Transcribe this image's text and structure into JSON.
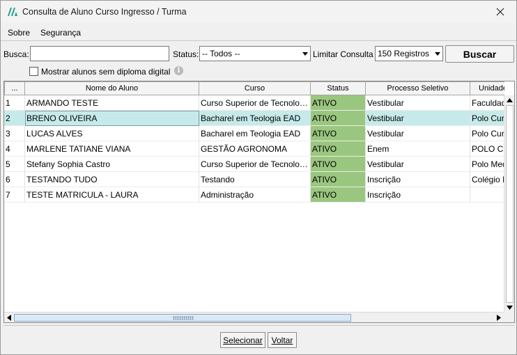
{
  "window": {
    "title": "Consulta de Aluno Curso Ingresso / Turma"
  },
  "menu": {
    "items": [
      "Sobre",
      "Segurança"
    ]
  },
  "filters": {
    "busca_label": "Busca:",
    "busca_value": "",
    "status_label": "Status:",
    "status_value": "-- Todos --",
    "limitar_label": "Limitar Consulta",
    "limitar_value": "150 Registros",
    "buscar_button": "Buscar",
    "checkbox_label": "Mostrar alunos sem diploma digital",
    "checkbox_checked": false
  },
  "table": {
    "columns": [
      "...",
      "Nome do Aluno",
      "Curso",
      "Status",
      "Processo Seletivo",
      "Unidade"
    ],
    "rows": [
      {
        "n": "1",
        "nome": "ARMANDO TESTE",
        "curso": "Curso Superior de Tecnologia",
        "status": "ATIVO",
        "processo": "Vestibular",
        "unidade": "Faculdade"
      },
      {
        "n": "2",
        "nome": "BRENO OLIVEIRA",
        "curso": "Bacharel em Teologia EAD",
        "status": "ATIVO",
        "processo": "Vestibular",
        "unidade": "Polo Cur"
      },
      {
        "n": "3",
        "nome": "LUCAS ALVES",
        "curso": "Bacharel em Teologia EAD",
        "status": "ATIVO",
        "processo": "Vestibular",
        "unidade": "Polo Cur"
      },
      {
        "n": "4",
        "nome": "MARLENE TATIANE VIANA",
        "curso": "GESTÃO AGRONOMA",
        "status": "ATIVO",
        "processo": "Enem",
        "unidade": " POLO C"
      },
      {
        "n": "5",
        "nome": "Stefany Sophia Castro",
        "curso": "Curso Superior de Tecnologia",
        "status": "ATIVO",
        "processo": "Vestibular",
        "unidade": "Polo Med"
      },
      {
        "n": "6",
        "nome": "TESTANDO TUDO",
        "curso": "Testando",
        "status": "ATIVO",
        "processo": "Inscrição",
        "unidade": "Colégio I"
      },
      {
        "n": "7",
        "nome": "TESTE MATRICULA - LAURA",
        "curso": "Administração",
        "status": "ATIVO",
        "processo": "Inscrição",
        "unidade": ""
      }
    ],
    "selected_row": 2
  },
  "footer": {
    "selecionar_button": "Selecionar",
    "voltar_button": "Voltar"
  },
  "colors": {
    "status_active": "#9ac77f",
    "row_selected": "#c6eaea",
    "app_icon": "#1e9e8e"
  },
  "icons": {
    "app": "app-logo-icon",
    "close": "close-icon",
    "info": "info-icon",
    "dropdown": "chevron-down-icon"
  }
}
